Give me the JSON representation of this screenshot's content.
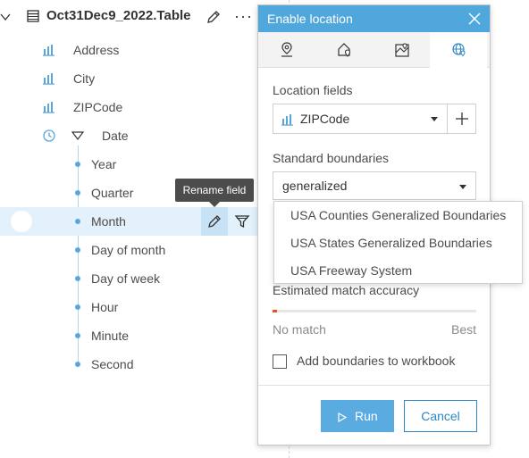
{
  "table": {
    "name": "Oct31Dec9_2022.Table",
    "more_label": "···"
  },
  "fields": [
    {
      "label": "Address",
      "icon": "string-field-icon"
    },
    {
      "label": "City",
      "icon": "string-field-icon"
    },
    {
      "label": "ZIPCode",
      "icon": "string-field-icon"
    },
    {
      "label": "Date",
      "icon": "date-field-icon"
    }
  ],
  "date_subfields": [
    "Year",
    "Quarter",
    "Month",
    "Day of month",
    "Day of week",
    "Hour",
    "Minute",
    "Second"
  ],
  "tooltip": "Rename field",
  "dialog": {
    "title": "Enable location",
    "tabs": [
      "coordinates-tab",
      "address-tab",
      "location-fields-tab",
      "boundaries-tab"
    ],
    "active_tab": "boundaries-tab",
    "location_fields_label": "Location fields",
    "location_field_value": "ZIPCode",
    "standard_boundaries_label": "Standard boundaries",
    "standard_boundaries_value": "generalized",
    "accuracy_label": "Estimated match accuracy",
    "accuracy_fraction": 0.02,
    "accuracy_low": "No match",
    "accuracy_high": "Best",
    "checkbox_label": "Add boundaries to workbook",
    "checkbox_checked": false,
    "run_label": "Run",
    "cancel_label": "Cancel"
  },
  "dropdown_options": [
    "USA Counties Generalized Boundaries",
    "USA States Generalized Boundaries",
    "USA Freeway System"
  ],
  "colors": {
    "accent": "#50a7dc",
    "selected_row": "#e2f1fb",
    "accuracy_fill": "#e2561a",
    "cancel_border": "#2d87c4"
  }
}
